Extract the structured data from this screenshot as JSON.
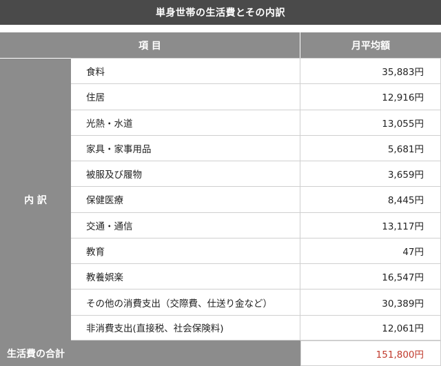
{
  "title": "単身世帯の生活費とその内訳",
  "header": {
    "item": "項 目",
    "amount": "月平均額"
  },
  "side_label": "内 訳",
  "rows": [
    {
      "name": "食料",
      "amount": "35,883円"
    },
    {
      "name": "住居",
      "amount": "12,916円"
    },
    {
      "name": "光熱・水道",
      "amount": "13,055円"
    },
    {
      "name": "家具・家事用品",
      "amount": "5,681円"
    },
    {
      "name": "被服及び履物",
      "amount": "3,659円"
    },
    {
      "name": "保健医療",
      "amount": "8,445円"
    },
    {
      "name": "交通・通信",
      "amount": "13,117円"
    },
    {
      "name": "教育",
      "amount": "47円"
    },
    {
      "name": "教養娯楽",
      "amount": "16,547円"
    },
    {
      "name": "その他の消費支出（交際費、仕送り金など）",
      "amount": "30,389円"
    },
    {
      "name": "非消費支出(直接税、社会保険料)",
      "amount": "12,061円"
    }
  ],
  "total": {
    "label": "生活費の合計",
    "amount": "151,800円"
  },
  "colors": {
    "accent_total": "#c0392b",
    "header_gray": "#8c8c8c",
    "title_bg": "#4a4a4a"
  }
}
